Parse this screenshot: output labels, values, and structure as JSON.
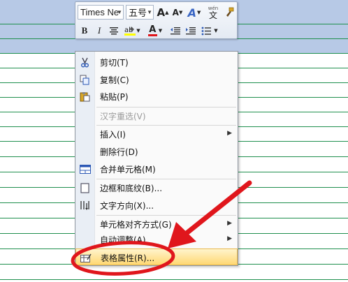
{
  "toolbar": {
    "font_name": "Times Ne",
    "font_size": "五号",
    "grow_glyph": "A",
    "shrink_glyph": "A",
    "style_glyph": "A",
    "phonetic_glyph": "文",
    "phonetic_top": "wén",
    "bold": "B",
    "italic": "I",
    "font_color_glyph": "A"
  },
  "menu": {
    "items": [
      {
        "label": "剪切(T)",
        "icon": "scissors-icon"
      },
      {
        "label": "复制(C)",
        "icon": "copy-icon"
      },
      {
        "label": "粘贴(P)",
        "icon": "paste-icon"
      },
      {
        "label": "汉字重选(V)",
        "disabled": true
      },
      {
        "label": "插入(I)",
        "submenu": true
      },
      {
        "label": "删除行(D)"
      },
      {
        "label": "合并单元格(M)",
        "icon": "merge-cells-icon"
      },
      {
        "label": "边框和底纹(B)...",
        "icon": "borders-icon"
      },
      {
        "label": "文字方向(X)...",
        "icon": "text-direction-icon"
      },
      {
        "label": "单元格对齐方式(G)",
        "submenu": true
      },
      {
        "label": "自动调整(A)",
        "submenu": true
      },
      {
        "label": "表格属性(R)...",
        "icon": "table-properties-icon",
        "highlighted": true
      }
    ]
  },
  "colors": {
    "row_line": "#1f8f4e",
    "selection": "#b7c9e6",
    "highlight": "#ffd873",
    "annotation": "#e0161c"
  }
}
